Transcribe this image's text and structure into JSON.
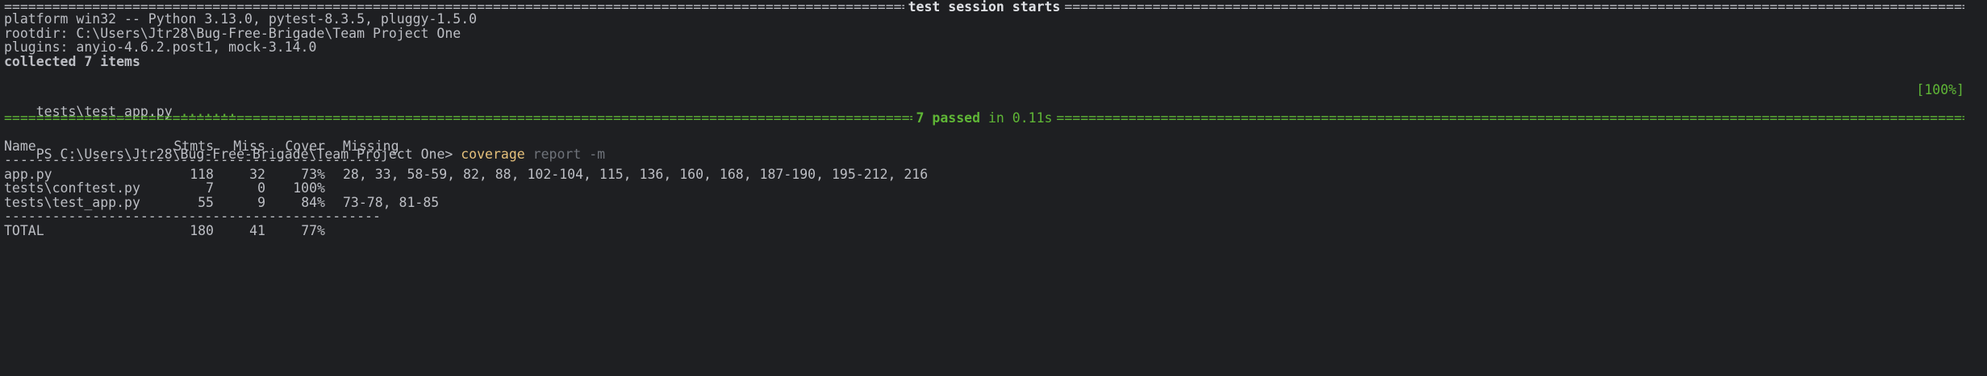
{
  "session": {
    "header_label": "test session starts",
    "platform": "platform win32 -- Python 3.13.0, pytest-8.3.5, pluggy-1.5.0",
    "rootdir": "rootdir: C:\\Users\\Jtr28\\Bug-Free-Brigade\\Team Project One",
    "plugins": "plugins: anyio-4.6.2.post1, mock-3.14.0",
    "collected": "collected 7 items",
    "test_file": "tests\\test_app.py",
    "test_dots": ".......",
    "progress": "[100%]",
    "summary_passed": "7 passed",
    "summary_time": "in 0.11s"
  },
  "prompt": {
    "path": "PS C:\\Users\\Jtr28\\Bug-Free-Brigade\\Team Project One>",
    "command": "coverage",
    "args": "report -m"
  },
  "coverage": {
    "headers": {
      "name": "Name",
      "stmts": "Stmts",
      "miss": "Miss",
      "cover": "Cover",
      "missing": "Missing"
    },
    "divider": "-----------------------------------------------",
    "rows": [
      {
        "name": "app.py",
        "stmts": "118",
        "miss": "32",
        "cover": "73%",
        "missing": "28, 33, 58-59, 82, 88, 102-104, 115, 136, 160, 168, 187-190, 195-212, 216"
      },
      {
        "name": "tests\\conftest.py",
        "stmts": "7",
        "miss": "0",
        "cover": "100%",
        "missing": ""
      },
      {
        "name": "tests\\test_app.py",
        "stmts": "55",
        "miss": "9",
        "cover": "84%",
        "missing": "73-78, 81-85"
      }
    ],
    "total": {
      "name": "TOTAL",
      "stmts": "180",
      "miss": "41",
      "cover": "77%"
    }
  },
  "colors": {
    "background": "#1e1f22",
    "text": "#bcbec4",
    "pass_green": "#5fb636",
    "command_yellow": "#e5c07b",
    "args_dim": "#6f737a"
  }
}
